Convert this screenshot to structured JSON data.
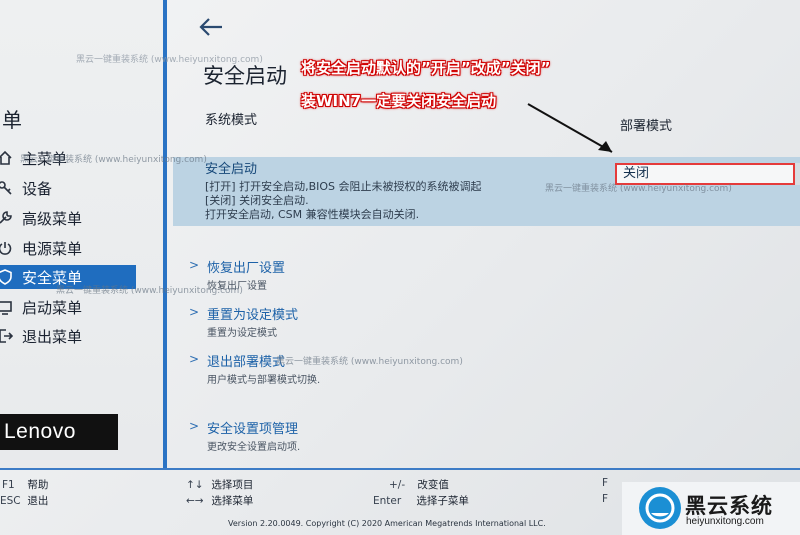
{
  "sidebar": {
    "title": "单",
    "items": [
      {
        "label": "主菜单",
        "icon": "home-icon"
      },
      {
        "label": "设备",
        "icon": "key-icon"
      },
      {
        "label": "高级菜单",
        "icon": "wrench-icon"
      },
      {
        "label": "电源菜单",
        "icon": "power-icon"
      },
      {
        "label": "安全菜单",
        "icon": "shield-icon",
        "active": true
      },
      {
        "label": "启动菜单",
        "icon": "boot-icon"
      },
      {
        "label": "退出菜单",
        "icon": "exit-icon"
      }
    ],
    "logo": "Lenovo"
  },
  "header": {
    "title": "安全启动"
  },
  "columns": {
    "left": "系统模式",
    "right": "部署模式"
  },
  "secure_boot": {
    "label": "安全启动",
    "desc_line1": "[打开] 打开安全启动,BIOS 会阻止未被授权的系统被调起",
    "desc_line2": "[关闭] 关闭安全启动.",
    "desc_line3": "打开安全启动, CSM 兼容性模块会自动关闭.",
    "value": "关闭"
  },
  "menu_items": [
    {
      "title": "恢复出厂设置",
      "sub": "恢复出厂设置"
    },
    {
      "title": "重置为设定模式",
      "sub": "重置为设定模式"
    },
    {
      "title": "退出部署模式",
      "sub": "用户模式与部署模式切换."
    },
    {
      "title": "安全设置项管理",
      "sub": "更改安全设置启动项."
    }
  ],
  "footer": {
    "keys": [
      {
        "key": "F1",
        "label": "帮助"
      },
      {
        "key": "ESC",
        "label": "退出"
      },
      {
        "key": "↑↓",
        "label": "选择项目"
      },
      {
        "key": "←→",
        "label": "选择菜单"
      },
      {
        "key": "+/-",
        "label": "改变值"
      },
      {
        "key": "Enter",
        "label": "选择子菜单"
      },
      {
        "key": "F",
        "label": ""
      },
      {
        "key": "F",
        "label": ""
      }
    ],
    "copyright": "Version 2.20.0049. Copyright (C) 2020 American Megatrends International LLC."
  },
  "annotations": {
    "line1": "将安全启动默认的”开启”改成”关闭”",
    "line2": "装WIN7一定要关闭安全启动",
    "accent": "#e53b3b"
  },
  "watermark": {
    "text1": "黑云一键重装系统 (www.heiyunxitong.com)",
    "text2": "黑云一键重装系统 (www.heiyunxitong.com)",
    "text3": "黑云一键重装系统 (www.heiyunxitong.com)",
    "text4": "黑云一键重装系统 (www.heiyunxitong.com)",
    "text5": "黑云一键重装系统 (www.heiyunxitong.com)",
    "brand_name": "黑云系统",
    "brand_url": "heiyunxitong.com"
  },
  "colors": {
    "accent": "#1f6dbf",
    "highlight_row": "#bcd3e3"
  }
}
